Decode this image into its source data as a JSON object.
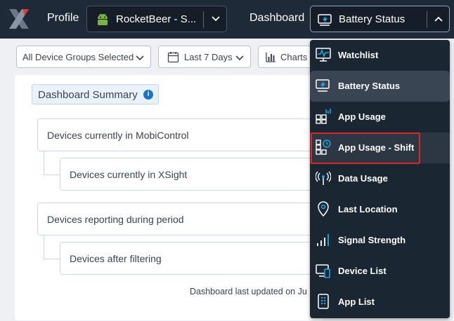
{
  "topbar": {
    "profile_label": "Profile",
    "profile_value": "RocketBeer - S...",
    "dashboard_label": "Dashboard",
    "dashboard_value": "Battery Status"
  },
  "filters": {
    "device_groups": "All Device Groups Selected",
    "date_range": "Last 7 Days",
    "charts": "Charts"
  },
  "summary": {
    "title": "Dashboard Summary",
    "info": "i",
    "rows": [
      "Devices currently in MobiControl",
      "Devices currently in XSight",
      "Devices reporting during period",
      "Devices after filtering"
    ],
    "updated": "Dashboard last updated on Ju"
  },
  "menu": {
    "items": [
      {
        "label": "Watchlist",
        "icon": "monitor-pulse-icon"
      },
      {
        "label": "Battery Status",
        "icon": "battery-status-icon"
      },
      {
        "label": "App Usage",
        "icon": "app-usage-icon"
      },
      {
        "label": "App Usage - Shift",
        "icon": "app-usage-shift-icon"
      },
      {
        "label": "Data Usage",
        "icon": "signal-tower-icon"
      },
      {
        "label": "Last Location",
        "icon": "location-pin-icon"
      },
      {
        "label": "Signal Strength",
        "icon": "signal-bars-icon"
      },
      {
        "label": "Device List",
        "icon": "devices-icon"
      },
      {
        "label": "App List",
        "icon": "phone-apps-icon"
      }
    ],
    "selected": "Battery Status",
    "highlighted": "App Usage - Shift"
  },
  "colors": {
    "topbar": "#1f2a38",
    "menu_bg": "#1b2633",
    "icon_accent": "#1ea7e8",
    "highlight_border": "#d8262c",
    "android_green": "#7cb342",
    "info_blue": "#1d72c6"
  }
}
